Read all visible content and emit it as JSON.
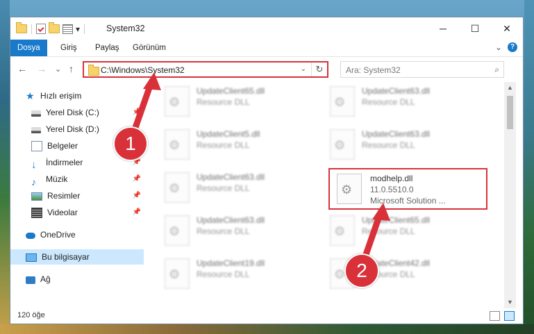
{
  "window": {
    "title": "System32",
    "controls": {
      "minimize": "─",
      "maximize": "☐",
      "close": "✕"
    }
  },
  "quick_access_toolbar": {
    "dropdown": "▾",
    "separator": "|"
  },
  "ribbon": {
    "tabs": [
      "Dosya",
      "Giriş",
      "Paylaş",
      "Görünüm"
    ],
    "active_tab": "Dosya",
    "expand": "⌄",
    "help": "?"
  },
  "address": {
    "back": "←",
    "forward": "→",
    "recent": "⌄",
    "up": "↑",
    "path": "C:\\Windows\\System32",
    "dropdown": "⌄",
    "refresh": "↻"
  },
  "search": {
    "placeholder": "Ara: System32",
    "icon": "search-icon"
  },
  "nav_pane": {
    "items": [
      {
        "label": "Hızlı erişim",
        "icon": "star-icon",
        "pinned": false
      },
      {
        "label": "Yerel Disk (C:)",
        "icon": "disk-icon",
        "pinned": true
      },
      {
        "label": "Yerel Disk (D:)",
        "icon": "disk-icon",
        "pinned": false
      },
      {
        "label": "Belgeler",
        "icon": "documents-icon",
        "pinned": true
      },
      {
        "label": "İndirmeler",
        "icon": "download-icon",
        "pinned": true
      },
      {
        "label": "Müzik",
        "icon": "music-icon",
        "pinned": true
      },
      {
        "label": "Resimler",
        "icon": "pictures-icon",
        "pinned": true
      },
      {
        "label": "Videolar",
        "icon": "videos-icon",
        "pinned": true
      },
      {
        "label": "OneDrive",
        "icon": "cloud-icon",
        "pinned": false
      },
      {
        "label": "Bu bilgisayar",
        "icon": "computer-icon",
        "pinned": false,
        "selected": true
      },
      {
        "label": "Ağ",
        "icon": "network-icon",
        "pinned": false
      }
    ],
    "pin_glyph": "📌"
  },
  "files": [
    {
      "name": "UpdateClient65.dll",
      "type": "Resource DLL",
      "blurred": true
    },
    {
      "name": "UpdateClient63.dll",
      "type": "Resource DLL",
      "blurred": true
    },
    {
      "name": "UpdateClient5.dll",
      "type": "Resource DLL",
      "blurred": true
    },
    {
      "name": "UpdateClient63.dll",
      "type": "Resource DLL",
      "blurred": true
    },
    {
      "name": "UpdateClient63.dll",
      "type": "Resource DLL",
      "blurred": true
    },
    {
      "name": "modhelp.dll",
      "version": "11.0.5510.0",
      "company": "Microsoft Solution ...",
      "blurred": false,
      "highlighted": true
    },
    {
      "name": "UpdateClient63.dll",
      "type": "Resource DLL",
      "blurred": true
    },
    {
      "name": "UpdateClient65.dll",
      "type": "Resource DLL",
      "blurred": true
    },
    {
      "name": "UpdateClient19.dll",
      "type": "Resource DLL",
      "blurred": true
    },
    {
      "name": "UpdateClient42.dll",
      "type": "Resource DLL",
      "blurred": true
    }
  ],
  "status": {
    "item_count": "120 öğe"
  },
  "annotations": {
    "step1": "1",
    "step2": "2",
    "accent_color": "#d9313a"
  },
  "colors": {
    "accent": "#1979ca",
    "highlight": "#d9313a",
    "selection": "#cce8ff"
  }
}
